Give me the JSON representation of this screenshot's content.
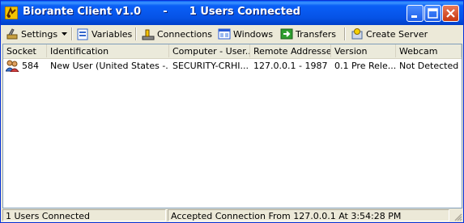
{
  "window": {
    "title": "Biorante Client v1.0      -      1 Users Connected"
  },
  "toolbar": {
    "settings": "Settings",
    "variables": "Variables",
    "connections": "Connections",
    "windows": "Windows",
    "transfers": "Transfers",
    "create_server": "Create Server"
  },
  "table": {
    "columns": [
      "Socket",
      "Identification",
      "Computer - User...",
      "Remote Addresse...",
      "Version",
      "Webcam"
    ],
    "rows": [
      [
        "584",
        "New User (United States -...",
        "SECURITY-CRHI...",
        "127.0.0.1 - 1987",
        "0.1 Pre Rele...",
        "Not Detected"
      ]
    ]
  },
  "statusbar": {
    "left": "1 Users Connected",
    "right": "Accepted Connection From 127.0.0.1 At 3:54:28 PM"
  },
  "colors": {
    "titlebar": "#0653e6",
    "face": "#ece9d8",
    "list_border": "#7f9db9"
  }
}
